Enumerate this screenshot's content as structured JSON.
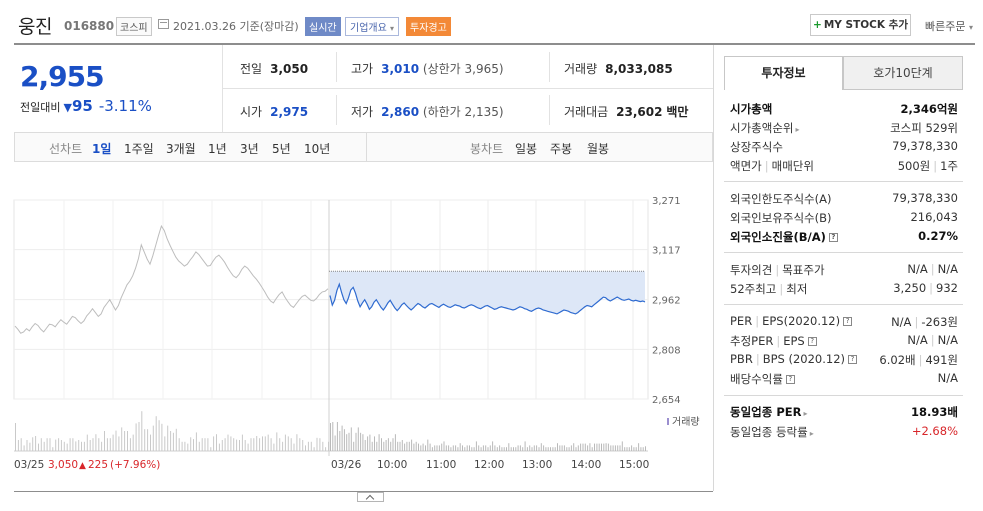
{
  "header": {
    "name": "웅진",
    "code": "016880",
    "market": "코스피",
    "date": "2021.03.26 기준(장마감)",
    "tag_realtime": "실시간",
    "tag_company": "기업개요",
    "tag_warning": "투자경고",
    "mystock_label": "MY STOCK 추가",
    "quick_order": "빠른주문"
  },
  "price": {
    "current": "2,955",
    "change_label": "전일대비",
    "change_value": "95",
    "change_pct": "-3.11%"
  },
  "summary": {
    "prev_label": "전일",
    "prev_value": "3,050",
    "high_label": "고가",
    "high_value": "3,010",
    "upper_limit": "(상한가 3,965)",
    "volume_label": "거래량",
    "volume_value": "8,033,085",
    "open_label": "시가",
    "open_value": "2,975",
    "low_label": "저가",
    "low_value": "2,860",
    "lower_limit": "(하한가 2,135)",
    "amount_label": "거래대금",
    "amount_value": "23,602",
    "amount_unit": "백만"
  },
  "range": {
    "line_label": "선차트",
    "line_items": [
      "1일",
      "1주일",
      "3개월",
      "1년",
      "3년",
      "5년",
      "10년"
    ],
    "selected": "1일",
    "candle_label": "봉차트",
    "candle_items": [
      "일봉",
      "주봉",
      "월봉"
    ]
  },
  "chart_data": {
    "type": "line",
    "y_ticks": [
      "3,271",
      "3,117",
      "2,962",
      "2,808",
      "2,654"
    ],
    "ylim": [
      2654,
      3271
    ],
    "reference_price": 3050,
    "volume_label": "거래량",
    "x_ticks": [
      "03/25",
      "03/26",
      "10:00",
      "11:00",
      "12:00",
      "13:00",
      "14:00",
      "15:00"
    ],
    "prev_summary": {
      "close": "3,050",
      "change": "225",
      "pct": "(+7.96%)"
    },
    "series": [
      {
        "segment": "03/25",
        "values": [
          2880,
          2870,
          2858,
          2862,
          2872,
          2865,
          2878,
          2888,
          2882,
          2870,
          2862,
          2874,
          2886,
          2884,
          2878,
          2890,
          2900,
          2892,
          2886,
          2898,
          2910,
          2906,
          2896,
          2888,
          2896,
          2912,
          2922,
          2934,
          2922,
          2910,
          2918,
          2938,
          2950,
          2962,
          2946,
          2930,
          2944,
          2968,
          2988,
          3008,
          3020,
          3036,
          3060,
          3090,
          3132,
          3110,
          3088,
          3072,
          3098,
          3130,
          3162,
          3190,
          3176,
          3150,
          3130,
          3112,
          3094,
          3082,
          3074,
          3066,
          3072,
          3085,
          3096,
          3110,
          3102,
          3090,
          3078,
          3066,
          3068,
          3082,
          3094,
          3100,
          3090,
          3078,
          3062,
          3048,
          3036,
          3030,
          3040,
          3056,
          3066,
          3060,
          3048,
          3036,
          3026,
          3014,
          3000,
          2986,
          2970,
          2958,
          2952,
          2966,
          2978,
          2986,
          2970,
          2956,
          2944,
          2938,
          2950,
          2962,
          2972,
          2976,
          2968,
          2960,
          2958,
          2966,
          2978,
          2986,
          2988,
          2996
        ]
      },
      {
        "segment": "03/26",
        "values": [
          2975,
          2945,
          2960,
          2990,
          3010,
          2984,
          2962,
          2950,
          2968,
          2992,
          3000,
          2982,
          2958,
          2940,
          2952,
          2962,
          2948,
          2932,
          2940,
          2954,
          2962,
          2950,
          2938,
          2930,
          2940,
          2952,
          2960,
          2948,
          2936,
          2928,
          2936,
          2946,
          2952,
          2944,
          2936,
          2930,
          2936,
          2944,
          2950,
          2946,
          2940,
          2936,
          2942,
          2948,
          2950,
          2946,
          2942,
          2938,
          2944,
          2948,
          2944,
          2940,
          2938,
          2942,
          2946,
          2944,
          2942,
          2938,
          2936,
          2940,
          2944,
          2946,
          2944,
          2940,
          2936,
          2934,
          2938,
          2942,
          2944,
          2940,
          2936,
          2932,
          2934,
          2938,
          2940,
          2938,
          2936,
          2934,
          2932,
          2930,
          2932,
          2936,
          2940,
          2938,
          2934,
          2932,
          2928,
          2926,
          2930,
          2934,
          2936,
          2934,
          2930,
          2928,
          2926,
          2924,
          2922,
          2920,
          2918,
          2922,
          2926,
          2930,
          2928,
          2926,
          2922,
          2920,
          2918,
          2922,
          2928,
          2934,
          2940,
          2944,
          2942,
          2940,
          2946,
          2952,
          2958,
          2964,
          2970,
          2968,
          2962,
          2958,
          2962,
          2966,
          2970,
          2966,
          2962,
          2960,
          2962,
          2964,
          2960,
          2958,
          2960,
          2958,
          2956,
          2958,
          2955
        ]
      }
    ]
  },
  "invest": {
    "tab_info": "투자정보",
    "tab_ask": "호가10단계",
    "mcap_label": "시가총액",
    "mcap_value": "2,346억원",
    "rank_label": "시가총액순위",
    "rank_value": "코스피 529위",
    "shares_label": "상장주식수",
    "shares_value": "79,378,330",
    "face_label": "액면가",
    "unit_label": "매매단위",
    "face_value": "500원",
    "unit_value": "1주",
    "foreign_limit_label": "외국인한도주식수(A)",
    "foreign_limit_value": "79,378,330",
    "foreign_hold_label": "외국인보유주식수(B)",
    "foreign_hold_value": "216,043",
    "foreign_ratio_label": "외국인소진율(B/A)",
    "foreign_ratio_value": "0.27%",
    "opinion_label": "투자의견",
    "target_label": "목표주가",
    "opinion_value": "N/A",
    "target_value": "N/A",
    "w52_high_label": "52주최고",
    "w52_low_label": "최저",
    "w52_high_value": "3,250",
    "w52_low_value": "932",
    "per_label": "PER",
    "eps_label": "EPS(2020.12)",
    "per_value": "N/A",
    "eps_value": "-263원",
    "est_per_label": "추정PER",
    "est_eps_label": "EPS",
    "est_per_value": "N/A",
    "est_eps_value": "N/A",
    "pbr_label": "PBR",
    "bps_label": "BPS (2020.12)",
    "pbr_value": "6.02배",
    "bps_value": "491원",
    "div_label": "배당수익률",
    "div_value": "N/A",
    "sector_per_label": "동일업종 PER",
    "sector_per_value": "18.93배",
    "sector_rate_label": "동일업종 등락률",
    "sector_rate_value": "+2.68%"
  }
}
